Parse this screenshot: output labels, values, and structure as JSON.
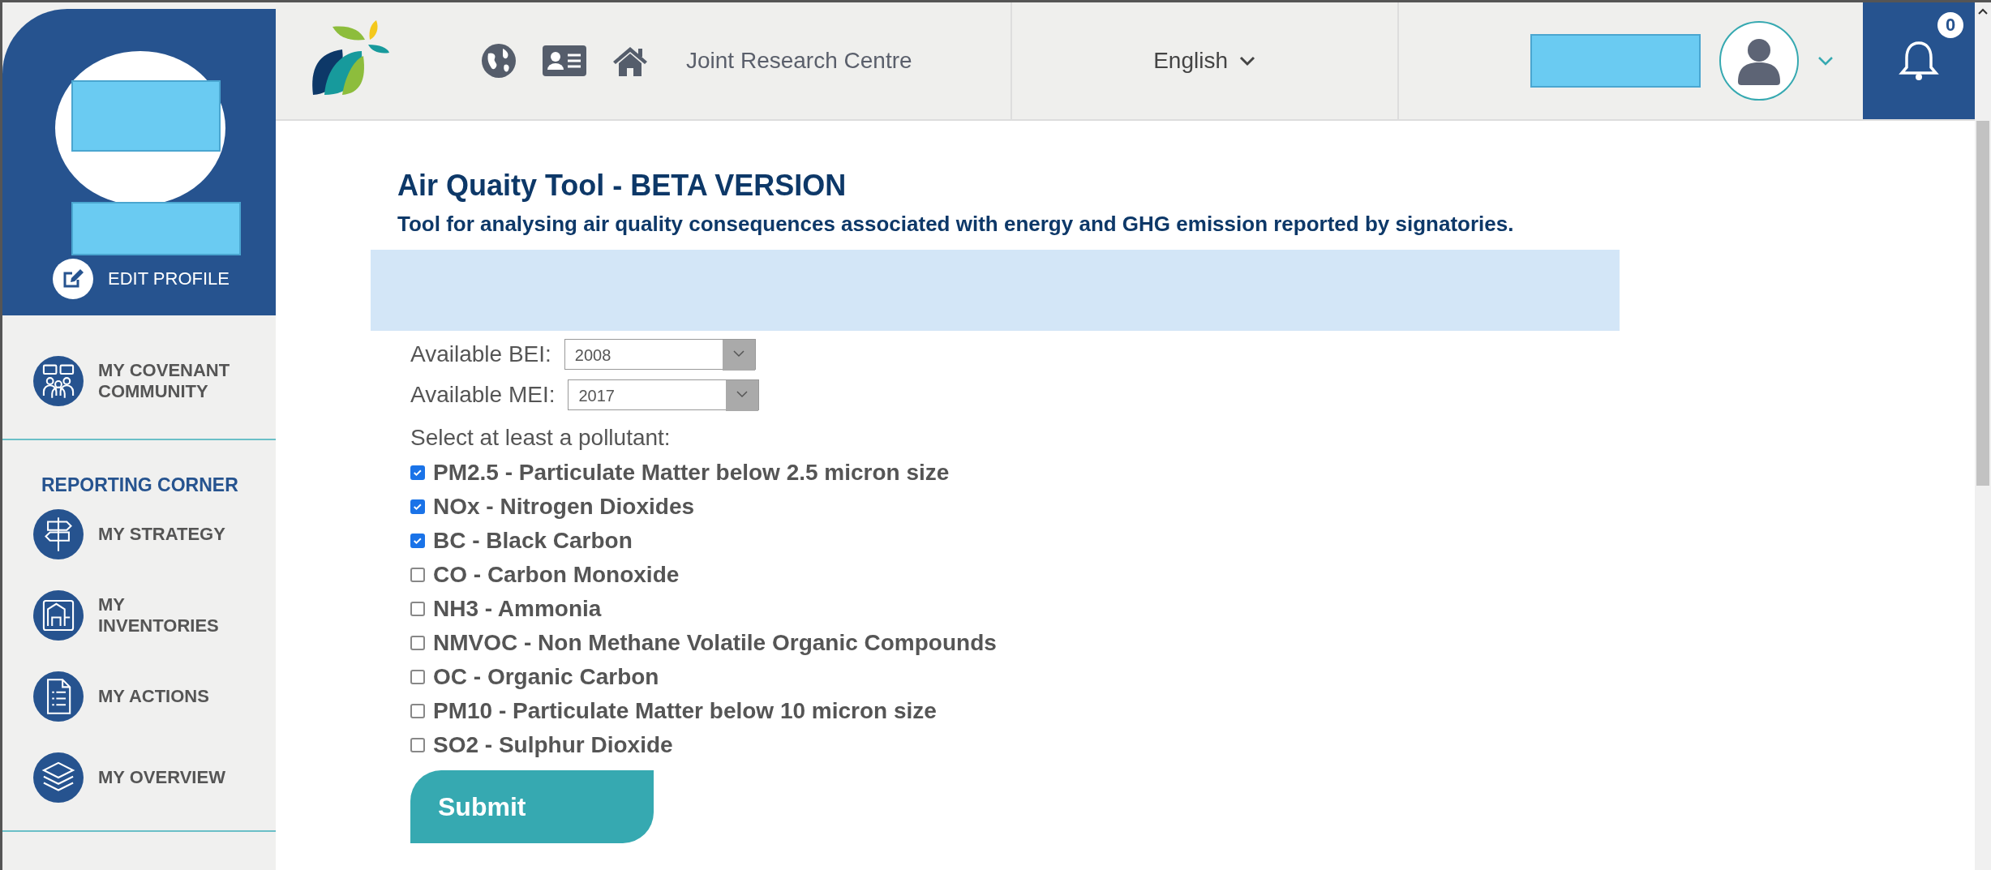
{
  "header": {
    "site_link": "Joint Research Centre",
    "language": "English",
    "notification_count": "0"
  },
  "sidebar": {
    "edit_profile": "EDIT PROFILE",
    "items": [
      {
        "label": "MY COVENANT COMMUNITY",
        "kind": "community"
      }
    ],
    "section_title": "REPORTING CORNER",
    "reporting_items": [
      {
        "label": "MY STRATEGY",
        "kind": "signpost"
      },
      {
        "label": "MY INVENTORIES",
        "kind": "blueprint"
      },
      {
        "label": "MY ACTIONS",
        "kind": "document"
      },
      {
        "label": "MY OVERVIEW",
        "kind": "layers"
      }
    ]
  },
  "page": {
    "title": "Air Quaity Tool - BETA VERSION",
    "subtitle": "Tool for analysing air quality consequences associated with energy and GHG emission reported by signatories.",
    "selects": [
      {
        "label": "Available BEI:",
        "value": "2008"
      },
      {
        "label": "Available MEI:",
        "value": "2017"
      }
    ],
    "pollutant_prompt": "Select at least a pollutant:",
    "pollutants": [
      {
        "label": "PM2.5 - Particulate Matter below 2.5 micron size",
        "checked": true
      },
      {
        "label": "NOx - Nitrogen Dioxides",
        "checked": true
      },
      {
        "label": "BC - Black Carbon",
        "checked": true
      },
      {
        "label": "CO - Carbon Monoxide",
        "checked": false
      },
      {
        "label": "NH3 - Ammonia",
        "checked": false
      },
      {
        "label": "NMVOC - Non Methane Volatile Organic Compounds",
        "checked": false
      },
      {
        "label": "OC - Organic Carbon",
        "checked": false
      },
      {
        "label": "PM10 - Particulate Matter below 10 micron size",
        "checked": false
      },
      {
        "label": "SO2 - Sulphur Dioxide",
        "checked": false
      }
    ],
    "submit": "Submit"
  }
}
